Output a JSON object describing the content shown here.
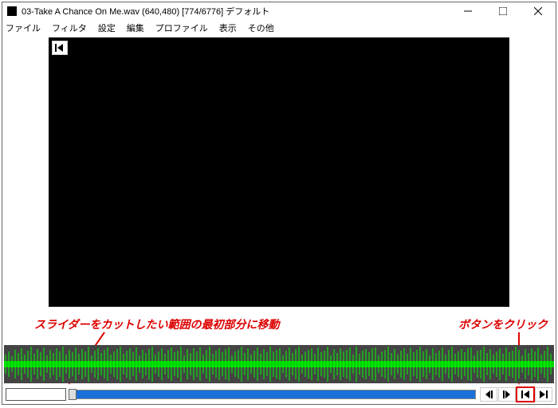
{
  "title": "03-Take A Chance On Me.wav (640,480)  [774/6776]  デフォルト",
  "menu": {
    "file": "ファイル",
    "filter": "フィルタ",
    "settings": "設定",
    "edit": "編集",
    "profile": "プロファイル",
    "view": "表示",
    "other": "その他"
  },
  "annotations": {
    "slider": "スライダーをカットしたい範囲の最初部分に移動",
    "button": "ボタンをクリック"
  },
  "position": ""
}
